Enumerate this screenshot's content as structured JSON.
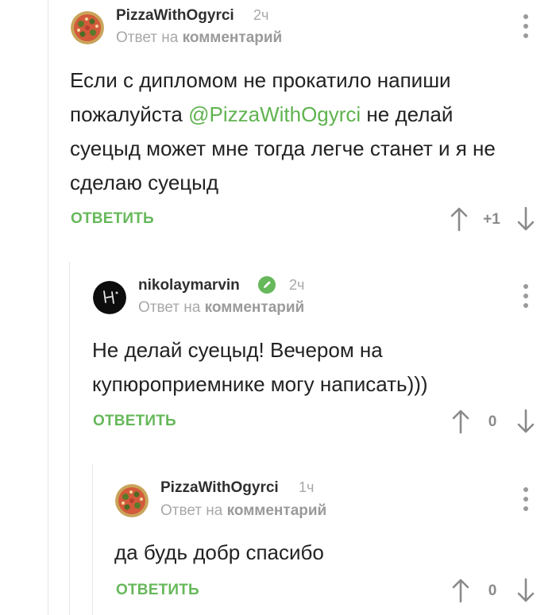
{
  "comments": [
    {
      "username": "PizzaWithOgyrci",
      "time": "2ч",
      "reply_prefix": "Ответ на",
      "reply_link": "комментарий",
      "text_before": "Если с дипломом не прокатило напиши пожалуйста ",
      "mention": "@PizzaWithOgyrci",
      "text_after": " не делай суецыд может мне тогда легче станет и я не сделаю суецыд",
      "reply_label": "ОТВЕТИТЬ",
      "rating": "+1",
      "avatar": "pizza-avatar"
    },
    {
      "username": "nikolaymarvin",
      "time": "2ч",
      "reply_prefix": "Ответ на",
      "reply_link": "комментарий",
      "text": "Не делай суецыд! Вечером на купюроприемнике могу написать)))",
      "reply_label": "ОТВЕТИТЬ",
      "rating": "0",
      "avatar": "dark-avatar",
      "badge": "pencil-icon"
    },
    {
      "username": "PizzaWithOgyrci",
      "time": "1ч",
      "reply_prefix": "Ответ на",
      "reply_link": "комментарий",
      "text": "да будь добр спасибо",
      "reply_label": "ОТВЕТИТЬ",
      "rating": "0",
      "avatar": "pizza-avatar"
    }
  ],
  "colors": {
    "accent_green": "#66b85a",
    "mention_green": "#5fb34e",
    "muted_gray": "#a8a8a8"
  }
}
